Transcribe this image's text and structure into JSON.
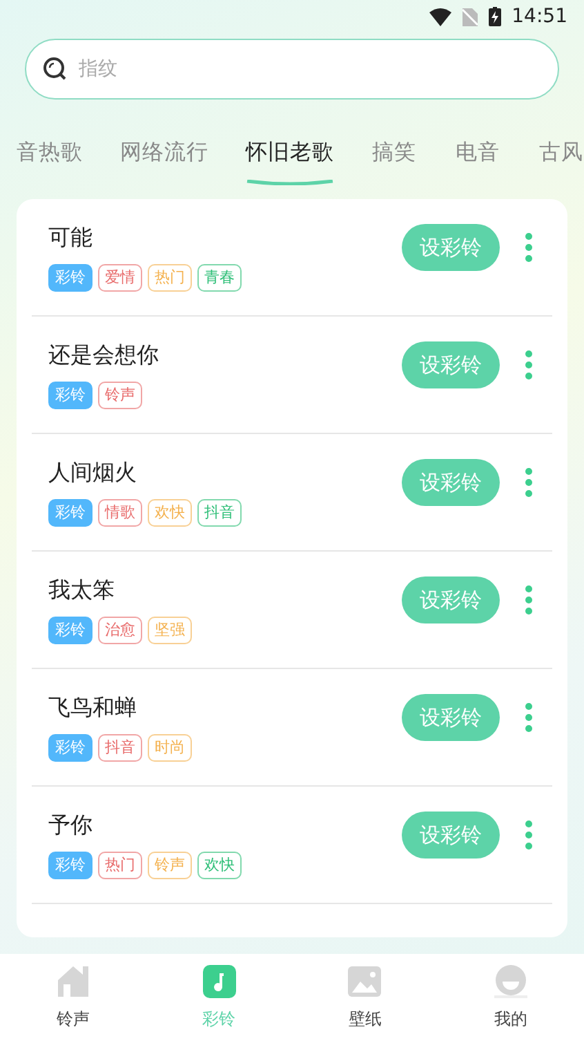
{
  "status_bar": {
    "time": "14:51"
  },
  "search": {
    "placeholder": "指纹"
  },
  "tabs": [
    {
      "label": "音热歌",
      "selected": false
    },
    {
      "label": "网络流行",
      "selected": false
    },
    {
      "label": "怀旧老歌",
      "selected": true
    },
    {
      "label": "搞笑",
      "selected": false
    },
    {
      "label": "电音",
      "selected": false
    },
    {
      "label": "古风",
      "selected": false
    }
  ],
  "songs": [
    {
      "title": "可能",
      "button": "设彩铃",
      "tags": [
        {
          "label": "彩铃",
          "kind": "filled",
          "color": "#52b7fb"
        },
        {
          "label": "爱情",
          "kind": "outline",
          "color": "#e86a6a"
        },
        {
          "label": "热门",
          "kind": "outline",
          "color": "#f4b14e"
        },
        {
          "label": "青春",
          "kind": "outline",
          "color": "#2fbf78"
        }
      ]
    },
    {
      "title": "还是会想你",
      "button": "设彩铃",
      "tags": [
        {
          "label": "彩铃",
          "kind": "filled",
          "color": "#52b7fb"
        },
        {
          "label": "铃声",
          "kind": "outline",
          "color": "#e86a6a"
        }
      ]
    },
    {
      "title": "人间烟火",
      "button": "设彩铃",
      "tags": [
        {
          "label": "彩铃",
          "kind": "filled",
          "color": "#52b7fb"
        },
        {
          "label": "情歌",
          "kind": "outline",
          "color": "#e86a6a"
        },
        {
          "label": "欢快",
          "kind": "outline",
          "color": "#f4b14e"
        },
        {
          "label": "抖音",
          "kind": "outline",
          "color": "#2fbf78"
        }
      ]
    },
    {
      "title": "我太笨",
      "button": "设彩铃",
      "tags": [
        {
          "label": "彩铃",
          "kind": "filled",
          "color": "#52b7fb"
        },
        {
          "label": "治愈",
          "kind": "outline",
          "color": "#e86a6a"
        },
        {
          "label": "坚强",
          "kind": "outline",
          "color": "#f4b14e"
        }
      ]
    },
    {
      "title": "飞鸟和蝉",
      "button": "设彩铃",
      "tags": [
        {
          "label": "彩铃",
          "kind": "filled",
          "color": "#52b7fb"
        },
        {
          "label": "抖音",
          "kind": "outline",
          "color": "#e86a6a"
        },
        {
          "label": "时尚",
          "kind": "outline",
          "color": "#f4b14e"
        }
      ]
    },
    {
      "title": "予你",
      "button": "设彩铃",
      "tags": [
        {
          "label": "彩铃",
          "kind": "filled",
          "color": "#52b7fb"
        },
        {
          "label": "热门",
          "kind": "outline",
          "color": "#e86a6a"
        },
        {
          "label": "铃声",
          "kind": "outline",
          "color": "#f4b14e"
        },
        {
          "label": "欢快",
          "kind": "outline",
          "color": "#2fbf78"
        }
      ]
    }
  ],
  "bottom_nav": [
    {
      "label": "铃声",
      "kind": "home",
      "selected": false
    },
    {
      "label": "彩铃",
      "kind": "music",
      "selected": true
    },
    {
      "label": "壁纸",
      "kind": "image",
      "selected": false
    },
    {
      "label": "我的",
      "kind": "profile",
      "selected": false
    }
  ]
}
